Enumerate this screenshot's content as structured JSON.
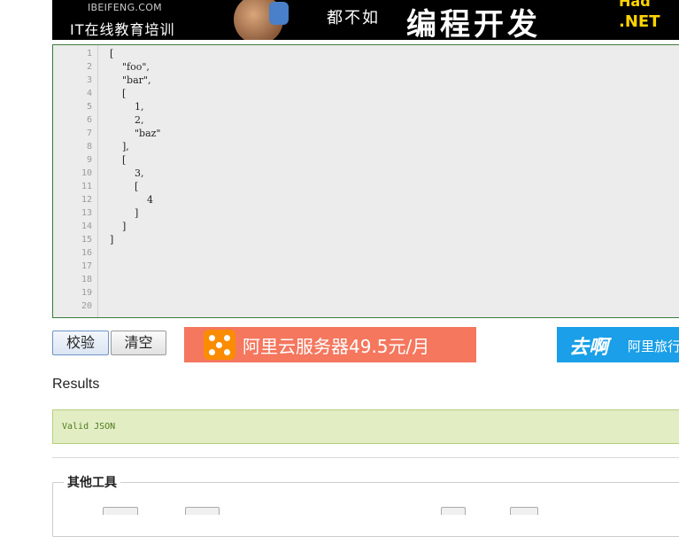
{
  "banner": {
    "site": "IBEIFENG.COM",
    "tagline": "IT在线教育培训",
    "scrawl": "都不如",
    "headline": "编程开发",
    "brand_top": "Had",
    "brand_net": ".NET"
  },
  "editor": {
    "lines": [
      "[",
      "    \"foo\",",
      "    \"bar\",",
      "    [",
      "        1,",
      "        2,",
      "        \"baz\"",
      "    ],",
      "    [",
      "        3,",
      "        [",
      "            4",
      "        ]",
      "    ]",
      "]",
      "",
      "",
      "",
      "",
      ""
    ],
    "line_numbers": [
      "1",
      "2",
      "3",
      "4",
      "5",
      "6",
      "7",
      "8",
      "9",
      "10",
      "11",
      "12",
      "13",
      "14",
      "15",
      "16",
      "17",
      "18",
      "19",
      "20"
    ]
  },
  "buttons": {
    "validate_label": "校验",
    "clear_label": "清空"
  },
  "ads": {
    "aliyun_text": "阿里云服务器49.5元/月",
    "qunar_brand": "去啊",
    "qunar_text": "阿里旅行"
  },
  "results": {
    "heading": "Results",
    "message": "Valid JSON"
  },
  "other_tools": {
    "legend": "其他工具"
  },
  "colors": {
    "editor_border": "#3a7d3a",
    "result_bg": "#e2edc4",
    "aliyun_bg": "#f4775e",
    "qunar_bg": "#1a9fe8"
  }
}
